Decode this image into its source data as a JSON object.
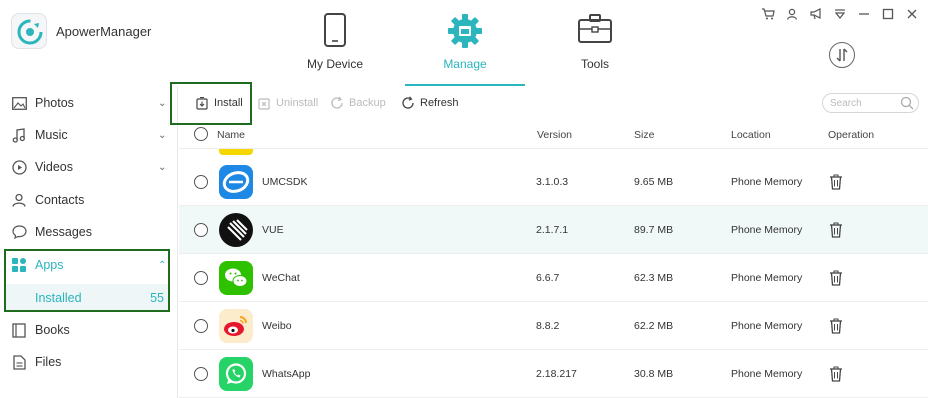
{
  "app": {
    "name": "ApowerManager"
  },
  "nav": {
    "tabs": [
      {
        "label": "My Device",
        "icon": "phone-icon"
      },
      {
        "label": "Manage",
        "icon": "gear-icon",
        "active": true
      },
      {
        "label": "Tools",
        "icon": "toolbox-icon"
      }
    ]
  },
  "window_controls": [
    "cart-icon",
    "user-icon",
    "megaphone-icon",
    "dropdown-icon",
    "minimize-icon",
    "maximize-icon",
    "close-icon"
  ],
  "sidebar": {
    "items": [
      {
        "label": "Photos",
        "icon": "photo-icon",
        "expandable": true
      },
      {
        "label": "Music",
        "icon": "music-icon",
        "expandable": true
      },
      {
        "label": "Videos",
        "icon": "video-icon",
        "expandable": true
      },
      {
        "label": "Contacts",
        "icon": "contact-icon"
      },
      {
        "label": "Messages",
        "icon": "message-icon"
      },
      {
        "label": "Apps",
        "icon": "apps-icon",
        "expanded": true
      },
      {
        "label": "Books",
        "icon": "book-icon"
      },
      {
        "label": "Files",
        "icon": "file-icon"
      }
    ],
    "sub_item": {
      "label": "Installed",
      "count": "55"
    }
  },
  "toolbar": {
    "install": "Install",
    "uninstall": "Uninstall",
    "backup": "Backup",
    "refresh": "Refresh"
  },
  "search": {
    "placeholder": "Search"
  },
  "table": {
    "headers": {
      "name": "Name",
      "version": "Version",
      "size": "Size",
      "location": "Location",
      "operation": "Operation"
    },
    "rows": [
      {
        "name": "UMCSDK",
        "version": "3.1.0.3",
        "size": "9.65 MB",
        "location": "Phone Memory"
      },
      {
        "name": "VUE",
        "version": "2.1.7.1",
        "size": "89.7 MB",
        "location": "Phone Memory"
      },
      {
        "name": "WeChat",
        "version": "6.6.7",
        "size": "62.3 MB",
        "location": "Phone Memory"
      },
      {
        "name": "Weibo",
        "version": "8.8.2",
        "size": "62.2 MB",
        "location": "Phone Memory"
      },
      {
        "name": "WhatsApp",
        "version": "2.18.217",
        "size": "30.8 MB",
        "location": "Phone Memory"
      }
    ]
  },
  "colors": {
    "accent": "#2bb5bd",
    "highlight_border": "#1f6b1f",
    "row_hover": "#f1f8f8"
  }
}
